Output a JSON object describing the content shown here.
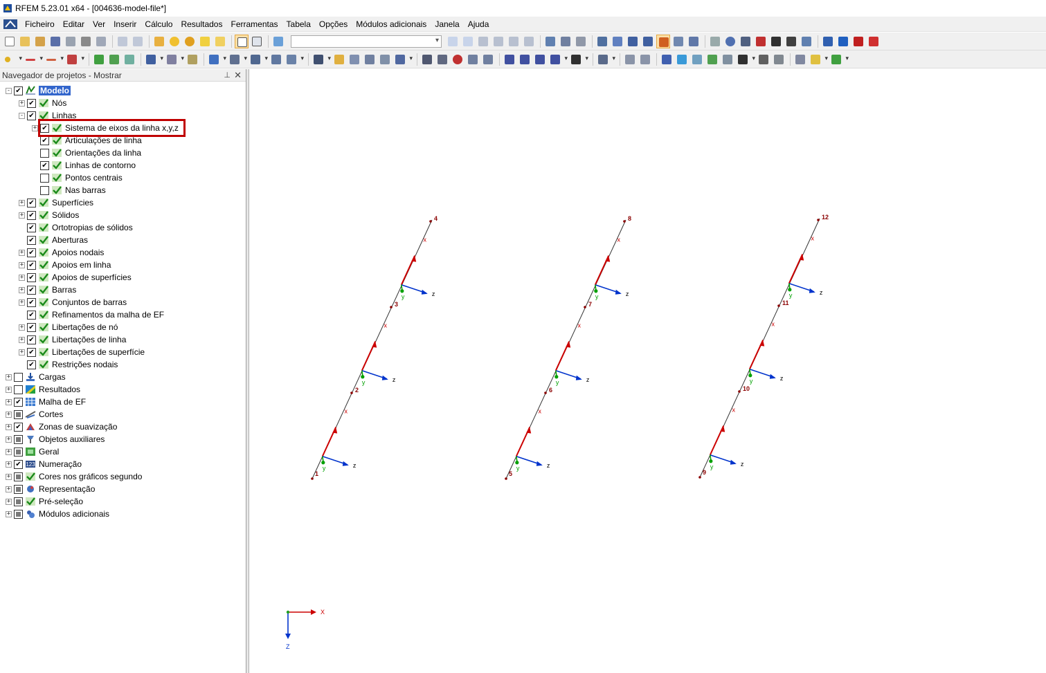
{
  "window": {
    "title": "RFEM 5.23.01 x64 - [004636-model-file*]"
  },
  "menu": [
    "Ficheiro",
    "Editar",
    "Ver",
    "Inserir",
    "Cálculo",
    "Resultados",
    "Ferramentas",
    "Tabela",
    "Opções",
    "Módulos adicionais",
    "Janela",
    "Ajuda"
  ],
  "navigator": {
    "title": "Navegador de projetos - Mostrar",
    "items": [
      {
        "label": "Modelo",
        "level": 0,
        "expand": "-",
        "check": "checked",
        "icon": "model-icon",
        "selected": true
      },
      {
        "label": "Nós",
        "level": 1,
        "expand": "+",
        "check": "checked",
        "icon": "display-check-icon"
      },
      {
        "label": "Linhas",
        "level": 1,
        "expand": "-",
        "check": "checked",
        "icon": "display-check-icon"
      },
      {
        "label": "Sistema de eixos da linha x,y,z",
        "level": 2,
        "expand": "+",
        "check": "checked",
        "icon": "display-check-icon"
      },
      {
        "label": "Articulações de linha",
        "level": 2,
        "expand": "",
        "check": "checked",
        "icon": "display-check-icon"
      },
      {
        "label": "Orientações da linha",
        "level": 2,
        "expand": "",
        "check": "unchecked",
        "icon": "display-check-icon"
      },
      {
        "label": "Linhas de contorno",
        "level": 2,
        "expand": "",
        "check": "checked",
        "icon": "display-check-icon"
      },
      {
        "label": "Pontos centrais",
        "level": 2,
        "expand": "",
        "check": "unchecked",
        "icon": "display-check-icon"
      },
      {
        "label": "Nas barras",
        "level": 2,
        "expand": "",
        "check": "unchecked",
        "icon": "display-check-icon"
      },
      {
        "label": "Superfícies",
        "level": 1,
        "expand": "+",
        "check": "checked",
        "icon": "display-check-icon"
      },
      {
        "label": "Sólidos",
        "level": 1,
        "expand": "+",
        "check": "checked",
        "icon": "display-check-icon"
      },
      {
        "label": "Ortotropias de sólidos",
        "level": 1,
        "expand": "",
        "check": "checked",
        "icon": "display-check-icon"
      },
      {
        "label": "Aberturas",
        "level": 1,
        "expand": "",
        "check": "checked",
        "icon": "display-check-icon"
      },
      {
        "label": "Apoios nodais",
        "level": 1,
        "expand": "+",
        "check": "checked",
        "icon": "display-check-icon"
      },
      {
        "label": "Apoios em linha",
        "level": 1,
        "expand": "+",
        "check": "checked",
        "icon": "display-check-icon"
      },
      {
        "label": "Apoios de superfícies",
        "level": 1,
        "expand": "+",
        "check": "checked",
        "icon": "display-check-icon"
      },
      {
        "label": "Barras",
        "level": 1,
        "expand": "+",
        "check": "checked",
        "icon": "display-check-icon"
      },
      {
        "label": "Conjuntos de barras",
        "level": 1,
        "expand": "+",
        "check": "checked",
        "icon": "display-check-icon"
      },
      {
        "label": "Refinamentos da malha de EF",
        "level": 1,
        "expand": "",
        "check": "checked",
        "icon": "display-check-icon"
      },
      {
        "label": "Libertações de nó",
        "level": 1,
        "expand": "+",
        "check": "checked",
        "icon": "display-check-icon"
      },
      {
        "label": "Libertações de linha",
        "level": 1,
        "expand": "+",
        "check": "checked",
        "icon": "display-check-icon"
      },
      {
        "label": "Libertações de superfície",
        "level": 1,
        "expand": "+",
        "check": "checked",
        "icon": "display-check-icon"
      },
      {
        "label": "Restrições nodais",
        "level": 1,
        "expand": "",
        "check": "checked",
        "icon": "display-check-icon"
      },
      {
        "label": "Cargas",
        "level": 0,
        "expand": "+",
        "check": "unchecked",
        "icon": "loads-icon"
      },
      {
        "label": "Resultados",
        "level": 0,
        "expand": "+",
        "check": "unchecked",
        "icon": "results-icon"
      },
      {
        "label": "Malha de EF",
        "level": 0,
        "expand": "+",
        "check": "checked",
        "icon": "mesh-icon"
      },
      {
        "label": "Cortes",
        "level": 0,
        "expand": "+",
        "check": "partial",
        "icon": "sections-icon"
      },
      {
        "label": "Zonas de suavização",
        "level": 0,
        "expand": "+",
        "check": "checked",
        "icon": "smoothing-icon"
      },
      {
        "label": "Objetos auxiliares",
        "level": 0,
        "expand": "+",
        "check": "partial",
        "icon": "aux-objects-icon"
      },
      {
        "label": "Geral",
        "level": 0,
        "expand": "+",
        "check": "partial",
        "icon": "general-icon"
      },
      {
        "label": "Numeração",
        "level": 0,
        "expand": "+",
        "check": "checked",
        "icon": "numbering-icon"
      },
      {
        "label": "Cores nos gráficos segundo",
        "level": 0,
        "expand": "+",
        "check": "partial",
        "icon": "display-check-icon"
      },
      {
        "label": "Representação",
        "level": 0,
        "expand": "+",
        "check": "partial",
        "icon": "rendering-icon"
      },
      {
        "label": "Pré-seleção",
        "level": 0,
        "expand": "+",
        "check": "partial",
        "icon": "display-check-icon"
      },
      {
        "label": "Módulos adicionais",
        "level": 0,
        "expand": "+",
        "check": "partial",
        "icon": "addon-modules-icon"
      }
    ]
  },
  "model": {
    "lines": [
      {
        "nodes": [
          "1",
          "2",
          "3",
          "4"
        ]
      },
      {
        "nodes": [
          "5",
          "6",
          "7",
          "8"
        ]
      },
      {
        "nodes": [
          "9",
          "10",
          "11",
          "12"
        ]
      }
    ],
    "local_axis_labels": {
      "x": "x",
      "y": "y",
      "z": "z"
    },
    "global_axes": {
      "x": "X",
      "z": "Z"
    }
  },
  "colors": {
    "selection": "#3366cc",
    "highlight_frame": "#c00000",
    "node_label": "#8b0000",
    "axis_x": "#cc0000",
    "axis_y": "#00a000",
    "axis_z": "#0033cc"
  }
}
